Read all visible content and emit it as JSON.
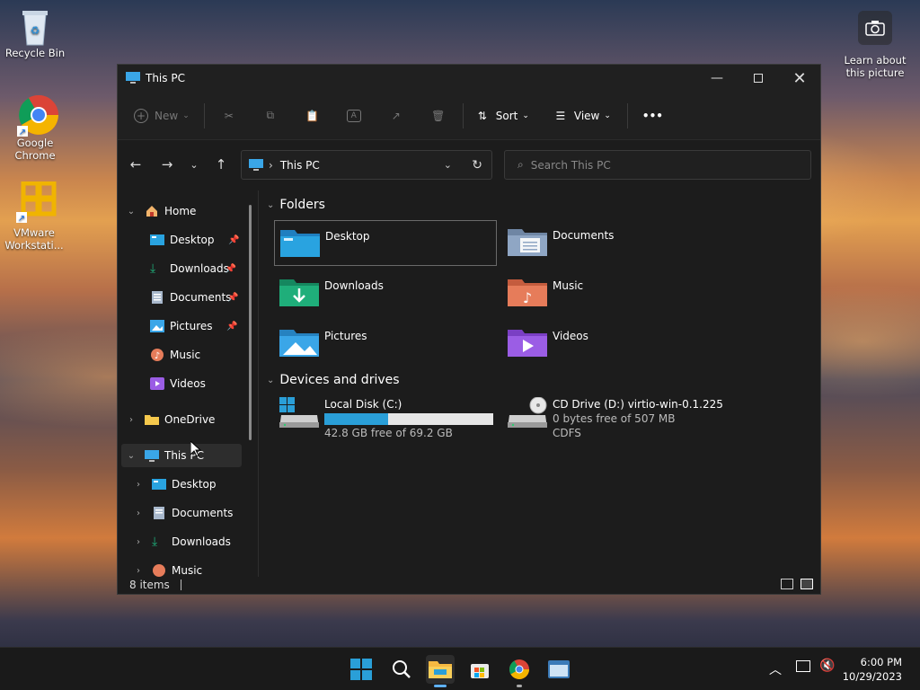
{
  "desktop": {
    "icons": [
      {
        "label": "Recycle Bin"
      },
      {
        "label": "Google Chrome"
      },
      {
        "label": "VMware Workstati..."
      }
    ],
    "learn": {
      "label": "Learn about this picture"
    }
  },
  "window": {
    "title": "This PC",
    "toolbar": {
      "new_label": "New",
      "sort_label": "Sort",
      "view_label": "View",
      "more_label": "•••"
    },
    "address": {
      "path": "This PC"
    },
    "search": {
      "placeholder": "Search This PC"
    },
    "sidebar": {
      "home": "Home",
      "quick": [
        {
          "label": "Desktop"
        },
        {
          "label": "Downloads"
        },
        {
          "label": "Documents"
        },
        {
          "label": "Pictures"
        },
        {
          "label": "Music"
        },
        {
          "label": "Videos"
        }
      ],
      "onedrive": "OneDrive",
      "thispc": "This PC",
      "thispc_children": [
        {
          "label": "Desktop"
        },
        {
          "label": "Documents"
        },
        {
          "label": "Downloads"
        },
        {
          "label": "Music"
        }
      ]
    },
    "sections": {
      "folders": "Folders",
      "drives": "Devices and drives"
    },
    "folders": [
      {
        "label": "Desktop",
        "color": "#29a3e0"
      },
      {
        "label": "Documents",
        "color": "#8fa6c4"
      },
      {
        "label": "Downloads",
        "color": "#1fae7a"
      },
      {
        "label": "Music",
        "color": "#e67c5a"
      },
      {
        "label": "Pictures",
        "color": "#3aa6e8"
      },
      {
        "label": "Videos",
        "color": "#9b5de5"
      }
    ],
    "drives": [
      {
        "name": "Local Disk (C:)",
        "free": "42.8 GB free of 69.2 GB",
        "used_fraction": 0.38
      },
      {
        "name": "CD Drive (D:) virtio-win-0.1.225",
        "free": "0 bytes free of 507 MB",
        "fs": "CDFS"
      }
    ],
    "status": {
      "items": "8 items"
    }
  },
  "taskbar": {
    "time": "6:00 PM",
    "date": "10/29/2023"
  },
  "colors": {
    "accent": "#2a9fd8",
    "window_bg": "#1c1c1c"
  }
}
